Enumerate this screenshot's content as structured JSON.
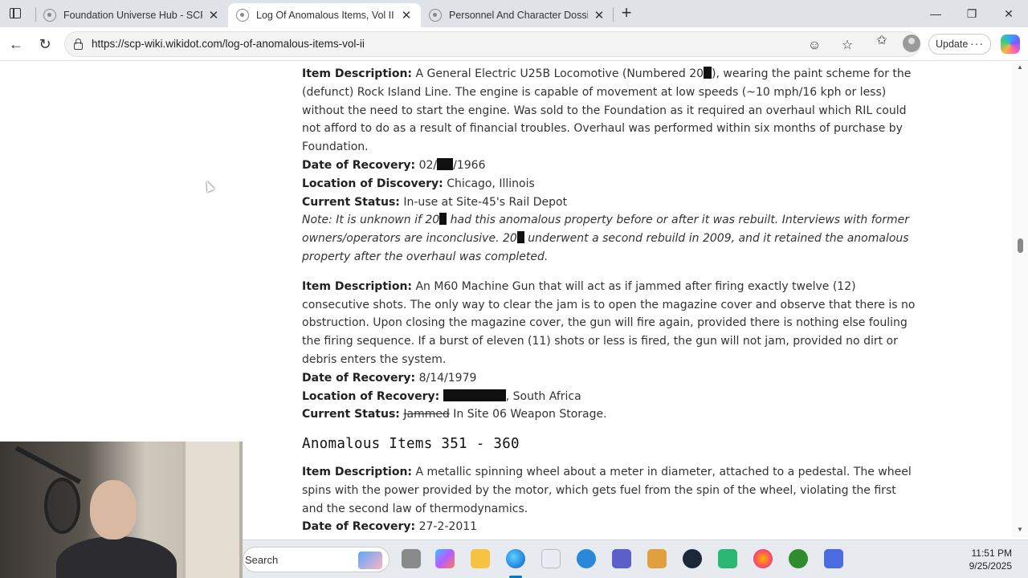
{
  "browser": {
    "tabs": [
      {
        "title": "Foundation Universe Hub - SCP F",
        "active": false
      },
      {
        "title": "Log Of Anomalous Items, Vol II - S",
        "active": true
      },
      {
        "title": "Personnel And Character Dossier",
        "active": false
      }
    ],
    "url": "https://scp-wiki.wikidot.com/log-of-anomalous-items-vol-ii",
    "update_label": "Update"
  },
  "content": {
    "item1": {
      "desc_label": "Item Description:",
      "desc_pre": "A General Electric U25B Locomotive (Numbered 20",
      "desc_post": "), wearing the paint scheme for the (defunct) Rock Island Line. The engine is capable of movement at low speeds (~10 mph/16 kph or less) without the need to start the engine. Was sold to the Foundation as it required an overhaul which RIL could not afford to do as a result of financial troubles. Overhaul was performed within six months of purchase by Foundation.",
      "date_label": "Date of Recovery:",
      "date_pre": "02/",
      "date_post": "/1966",
      "loc_label": "Location of Discovery:",
      "loc_value": "Chicago, Illinois",
      "status_label": "Current Status:",
      "status_value": "In-use at Site-45's Rail Depot",
      "note_a": "Note: It is unknown if 20",
      "note_b": "had this anomalous property before or after it was rebuilt. Interviews with former owners/operators are inconclusive. 20",
      "note_c": "underwent a second rebuild in 2009, and it retained the anomalous property after the overhaul was completed."
    },
    "item2": {
      "desc_label": "Item Description:",
      "desc_value": "An M60 Machine Gun that will act as if jammed after firing exactly twelve (12) consecutive shots. The only way to clear the jam is to open the magazine cover and observe that there is no obstruction. Upon closing the magazine cover, the gun will fire again, provided there is nothing else fouling the firing sequence. If a burst of eleven (11) shots or less is fired, the gun will not jam, provided no dirt or debris enters the system.",
      "date_label": "Date of Recovery:",
      "date_value": "8/14/1979",
      "loc_label": "Location of Recovery:",
      "loc_value": ", South Africa",
      "status_label": "Current Status:",
      "status_struck": "Jammed",
      "status_value": "In Site 06 Weapon Storage."
    },
    "section_heading": "Anomalous Items 351 - 360",
    "item3": {
      "desc_label": "Item Description:",
      "desc_value": "A metallic spinning wheel about a meter in diameter, attached to a pedestal. The wheel spins with the power provided by the motor, which gets fuel from the spin of the wheel, violating the first and the second law of thermodynamics.",
      "date_label": "Date of Recovery:",
      "date_value": "27-2-2011"
    }
  },
  "taskbar": {
    "search_label": "Search",
    "time": "11:51 PM",
    "date": "9/25/2025"
  }
}
